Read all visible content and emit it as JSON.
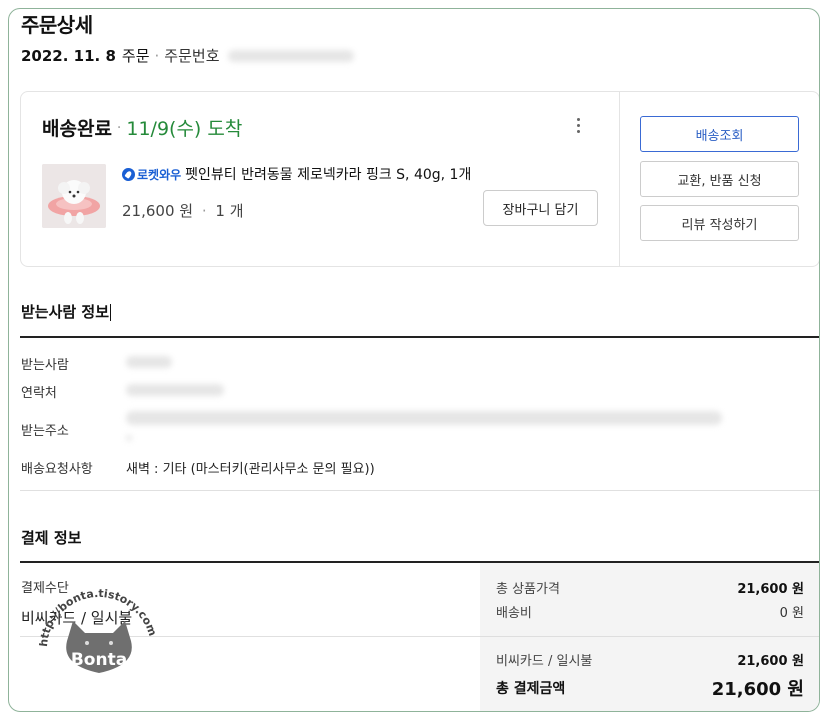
{
  "page": {
    "title": "주문상세",
    "order_date": "2022. 11. 8",
    "order_word": "주문",
    "order_no_label": "주문번호"
  },
  "order_card": {
    "status": "배송완료",
    "arrival": "11/9(수) 도착",
    "rocket_label": "로켓와우",
    "product_name": "펫인뷰티 반려동물 제로넥카라 핑크 S, 40g, 1개",
    "price": "21,600 원",
    "quantity": "1 개",
    "cart_button": "장바구니 담기",
    "actions": {
      "track": "배송조회",
      "exchange_return": "교환, 반품 신청",
      "review": "리뷰 작성하기"
    }
  },
  "recipient": {
    "title": "받는사람 정보",
    "name_label": "받는사람",
    "phone_label": "연락처",
    "address_label": "받는주소",
    "request_label": "배송요청사항",
    "request_value": "새벽 : 기타 (마스터키(관리사무소 문의 필요))"
  },
  "payment": {
    "title": "결제 정보",
    "method_label": "결제수단",
    "method_value": "비씨카드 / 일시불",
    "total_goods_label": "총 상품가격",
    "total_goods_value": "21,600 원",
    "shipping_label": "배송비",
    "shipping_value": "0 원",
    "card_label": "비씨카드 / 일시불",
    "card_value": "21,600 원",
    "final_label": "총 결제금액",
    "final_value": "21,600 원"
  },
  "watermark": {
    "url": "http://bonta.tistory.com",
    "name": "Bonta"
  },
  "colors": {
    "arrival": "#258a3a",
    "rocket": "#1a5fd4",
    "primary_button": "#2a5ec4",
    "frame_border": "#8fb39a"
  }
}
